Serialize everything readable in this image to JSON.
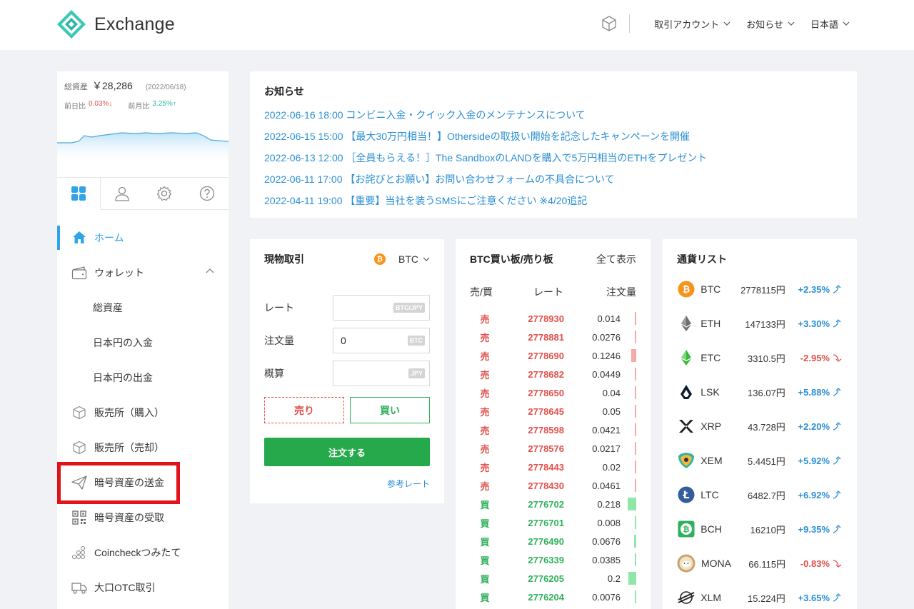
{
  "header": {
    "logo_text": "Exchange",
    "menus": [
      {
        "label": "取引アカウント"
      },
      {
        "label": "お知らせ"
      },
      {
        "label": "日本語"
      }
    ]
  },
  "sidebar": {
    "assets": {
      "label": "総資産",
      "value": "￥28,286",
      "date": "(2022/06/18)",
      "daily_label": "前日比",
      "daily_value": "0.03%↓",
      "monthly_label": "前月比",
      "monthly_value": "3.25%↑"
    },
    "tabs": [
      "dashboard-icon",
      "user-icon",
      "gear-icon",
      "help-icon"
    ],
    "nav": [
      {
        "label": "ホーム",
        "icon": "home-icon",
        "active": true
      },
      {
        "label": "ウォレット",
        "icon": "wallet-icon"
      },
      {
        "label": "総資産"
      },
      {
        "label": "日本円の入金"
      },
      {
        "label": "日本円の出金"
      },
      {
        "label": "販売所（購入）",
        "icon": "box-icon"
      },
      {
        "label": "販売所（売却）",
        "icon": "box-icon"
      },
      {
        "label": "暗号資産の送金",
        "icon": "send-icon"
      },
      {
        "label": "暗号資産の受取",
        "icon": "qr-icon"
      },
      {
        "label": "Coincheckつみたて",
        "icon": "coins-icon"
      },
      {
        "label": "大口OTC取引",
        "icon": "truck-icon"
      }
    ]
  },
  "notices": {
    "title": "お知らせ",
    "items": [
      "2022-06-16 18:00 コンビニ入金・クイック入金のメンテナンスについて",
      "2022-06-15 15:00 【最大30万円相当！】Othersideの取扱い開始を記念したキャンペーンを開催",
      "2022-06-13 12:00 ［全員もらえる！］The SandboxのLANDを購入で5万円相当のETHをプレゼント",
      "2022-06-11 17:00 【お詫びとお願い】お問い合わせフォームの不具合について",
      "2022-04-11 19:00 【重要】当社を装うSMSにご注意ください ※4/20追記"
    ]
  },
  "trade": {
    "title": "現物取引",
    "pair": "BTC",
    "pair_icon": "₿",
    "rate_label": "レート",
    "rate_unit": "BTC/JPY",
    "amount_label": "注文量",
    "amount_value": "0",
    "amount_unit": "BTC",
    "estimate_label": "概算",
    "estimate_unit": "JPY",
    "sell_label": "売り",
    "buy_label": "買い",
    "order_label": "注文する",
    "ref_label": "参考レート"
  },
  "book": {
    "title": "BTC買い板/売り板",
    "show_all": "全て表示",
    "col_side": "売/買",
    "col_rate": "レート",
    "col_amount": "注文量",
    "rows": [
      {
        "side": "売",
        "type": "sell",
        "rate": "2778930",
        "amount": "0.014",
        "depth": 0.05
      },
      {
        "side": "売",
        "type": "sell",
        "rate": "2778881",
        "amount": "0.0276",
        "depth": 0.08
      },
      {
        "side": "売",
        "type": "sell",
        "rate": "2778690",
        "amount": "0.1246",
        "depth": 0.5
      },
      {
        "side": "売",
        "type": "sell",
        "rate": "2778682",
        "amount": "0.0449",
        "depth": 0.15
      },
      {
        "side": "売",
        "type": "sell",
        "rate": "2778650",
        "amount": "0.04",
        "depth": 0.13
      },
      {
        "side": "売",
        "type": "sell",
        "rate": "2778645",
        "amount": "0.05",
        "depth": 0.17
      },
      {
        "side": "売",
        "type": "sell",
        "rate": "2778598",
        "amount": "0.0421",
        "depth": 0.14
      },
      {
        "side": "売",
        "type": "sell",
        "rate": "2778576",
        "amount": "0.0217",
        "depth": 0.07
      },
      {
        "side": "売",
        "type": "sell",
        "rate": "2778443",
        "amount": "0.02",
        "depth": 0.07
      },
      {
        "side": "売",
        "type": "sell",
        "rate": "2778430",
        "amount": "0.0461",
        "depth": 0.15
      },
      {
        "side": "買",
        "type": "buy",
        "rate": "2776702",
        "amount": "0.218",
        "depth": 0.85
      },
      {
        "side": "買",
        "type": "buy",
        "rate": "2776701",
        "amount": "0.008",
        "depth": 0.03
      },
      {
        "side": "買",
        "type": "buy",
        "rate": "2776490",
        "amount": "0.0676",
        "depth": 0.22
      },
      {
        "side": "買",
        "type": "buy",
        "rate": "2776339",
        "amount": "0.0385",
        "depth": 0.13
      },
      {
        "side": "買",
        "type": "buy",
        "rate": "2776205",
        "amount": "0.2",
        "depth": 0.8
      },
      {
        "side": "買",
        "type": "buy",
        "rate": "2776204",
        "amount": "0.0076",
        "depth": 0.03
      }
    ]
  },
  "currencies": {
    "title": "通貨リスト",
    "items": [
      {
        "symbol": "BTC",
        "price": "2778115円",
        "change": "+2.35%",
        "dir": "up",
        "icon": "bitcoin-icon"
      },
      {
        "symbol": "ETH",
        "price": "147133円",
        "change": "+3.30%",
        "dir": "up",
        "icon": "ethereum-icon"
      },
      {
        "symbol": "ETC",
        "price": "3310.5円",
        "change": "-2.95%",
        "dir": "down",
        "icon": "ethereum-classic-icon"
      },
      {
        "symbol": "LSK",
        "price": "136.07円",
        "change": "+5.88%",
        "dir": "up",
        "icon": "lisk-icon"
      },
      {
        "symbol": "XRP",
        "price": "43.728円",
        "change": "+2.20%",
        "dir": "up",
        "icon": "xrp-icon"
      },
      {
        "symbol": "XEM",
        "price": "5.4451円",
        "change": "+5.92%",
        "dir": "up",
        "icon": "nem-icon"
      },
      {
        "symbol": "LTC",
        "price": "6482.7円",
        "change": "+6.92%",
        "dir": "up",
        "icon": "litecoin-icon"
      },
      {
        "symbol": "BCH",
        "price": "16210円",
        "change": "+9.35%",
        "dir": "up",
        "icon": "bitcoin-cash-icon"
      },
      {
        "symbol": "MONA",
        "price": "66.115円",
        "change": "-0.83%",
        "dir": "down",
        "icon": "monacoin-icon"
      },
      {
        "symbol": "XLM",
        "price": "15.224円",
        "change": "+3.65%",
        "dir": "up",
        "icon": "stellar-icon"
      }
    ]
  },
  "colors": {
    "accent": "#2fa4e7",
    "sell": "#e2504c",
    "buy": "#2fb15b",
    "highlight": "#e0121a"
  }
}
